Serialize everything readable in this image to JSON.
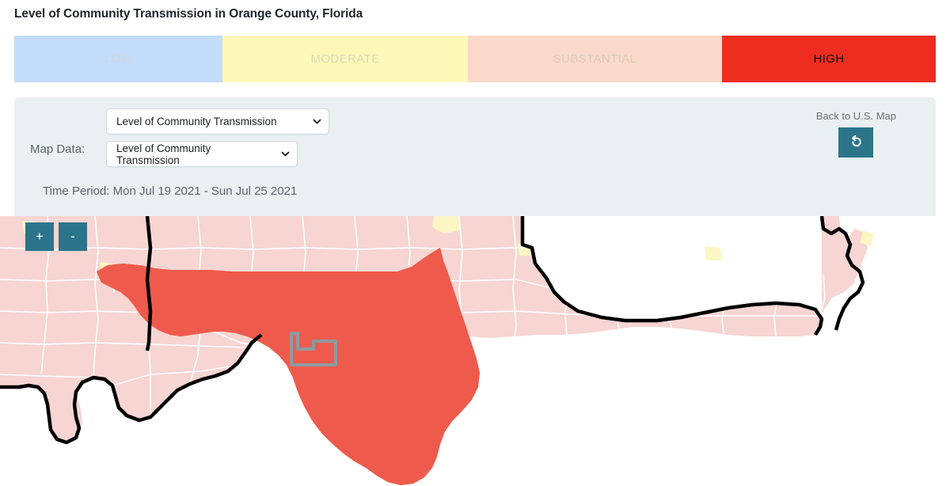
{
  "page_title": "Level of Community Transmission in Orange County, Florida",
  "legend": {
    "segments": [
      {
        "label": "LOW",
        "color": "#c3dcfa",
        "active": false
      },
      {
        "label": "MODERATE",
        "color": "#fdf8b8",
        "active": false
      },
      {
        "label": "SUBSTANTIAL",
        "color": "#f9d9c9",
        "active": false
      },
      {
        "label": "HIGH",
        "color": "#ee2d21",
        "active": true
      }
    ]
  },
  "controls": {
    "map_data_label": "Map Data:",
    "primary_select": {
      "value": "Level of Community Transmission",
      "options": [
        "Level of Community Transmission"
      ]
    },
    "secondary_select": {
      "value": "Level of Community Transmission",
      "options": [
        "Level of Community Transmission"
      ]
    },
    "time_period": "Time Period: Mon Jul 19 2021 - Sun Jul 25 2021",
    "back_label": "Back to U.S. Map",
    "back_icon": "undo-arrow-icon",
    "accent_color": "#2b7489"
  },
  "map": {
    "zoom_in_label": "+",
    "zoom_out_label": "-",
    "selected_county": "Orange County",
    "selected_state": "Florida",
    "selected_outline_color": "#8d9aa0",
    "state_fill_high": "#ee5b4c",
    "neighbor_fill_substantial": "#f6d5d2",
    "neighbor_fill_moderate": "#fbf6c4",
    "county_border_color": "#ffffff",
    "state_border_color": "#000000",
    "ocean_color": "#ffffff"
  }
}
